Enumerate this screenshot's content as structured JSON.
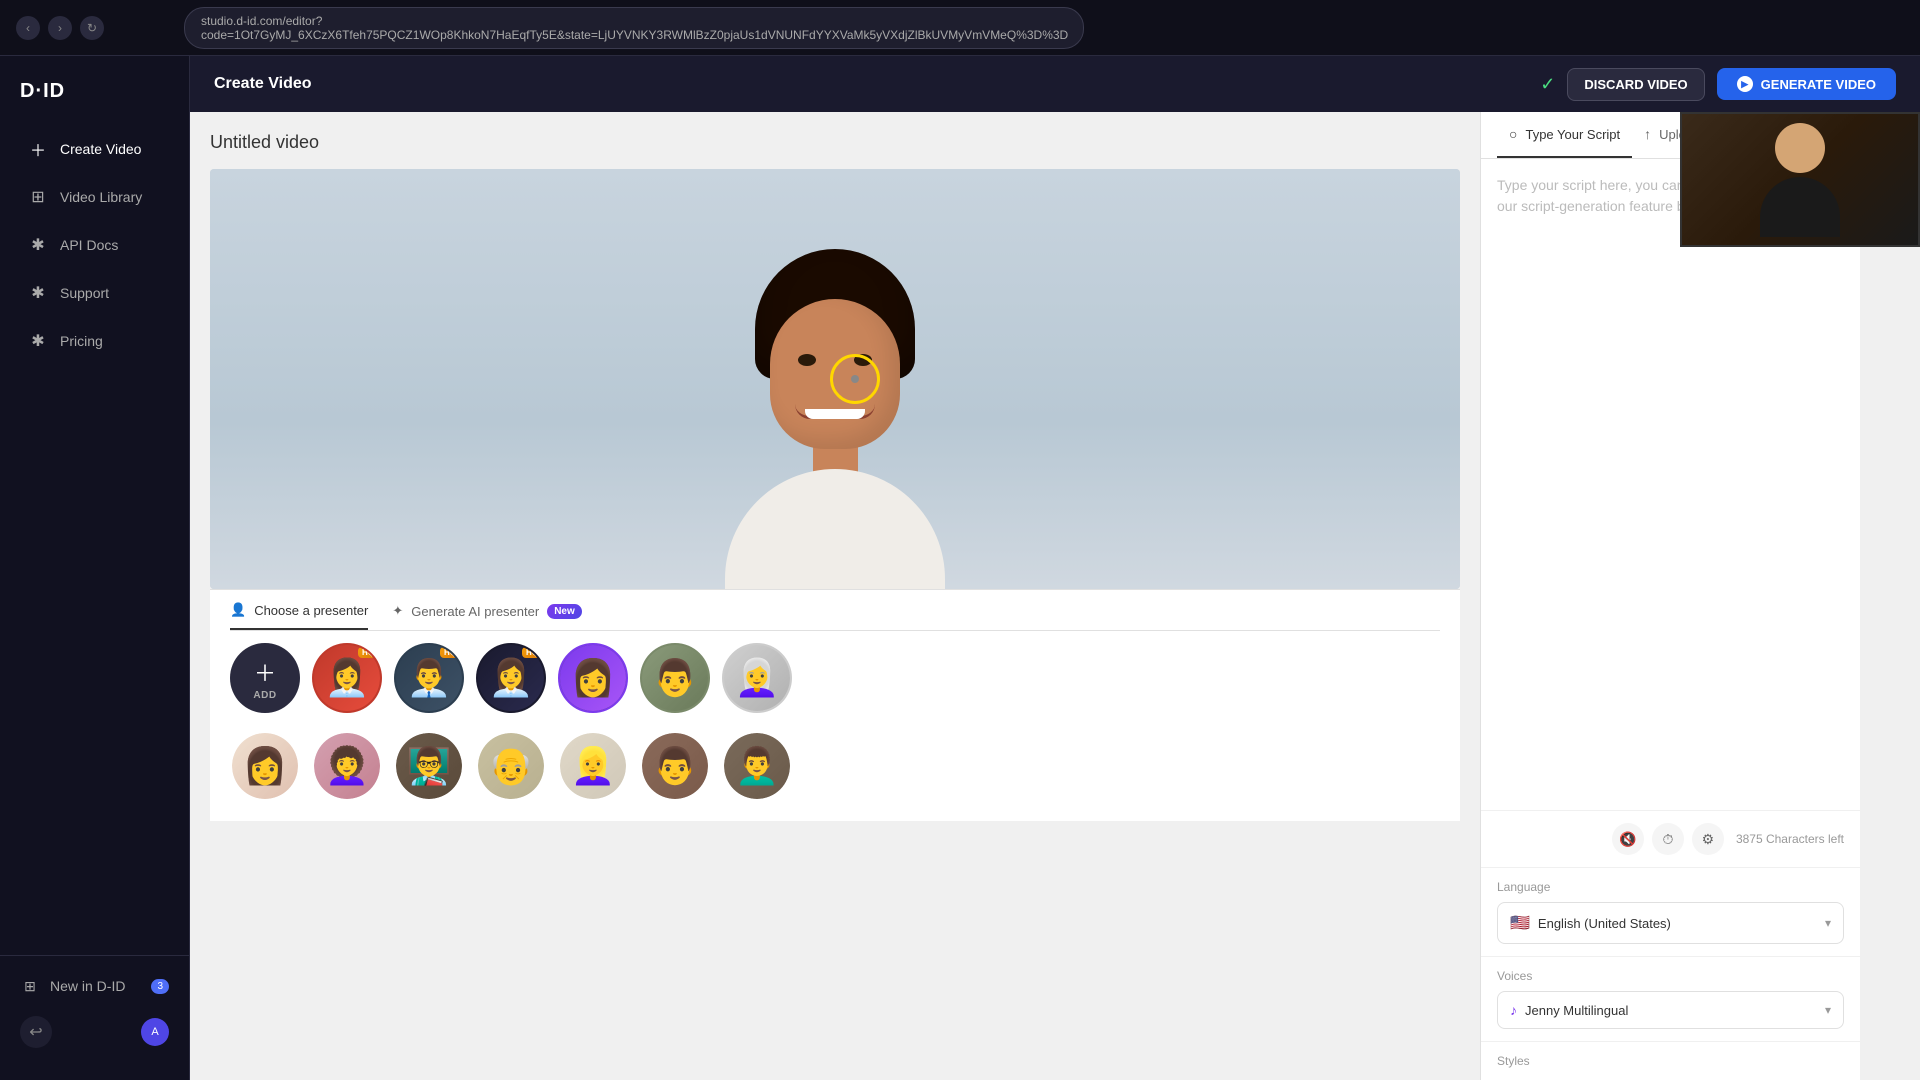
{
  "browser": {
    "url": "studio.d-id.com/editor?code=1Ot7GyMJ_6XCzX6Tfeh75PQCZ1WOp8KhkoN7HaEqfTy5E&state=LjUYVNKY3RWMlBzZ0pjaUs1dVNUNFdYYXVaMk5yVXdjZlBkUVMyVmVMeQ%3D%3D"
  },
  "header": {
    "title": "Create Video",
    "discard_btn": "DISCARD VIDEO",
    "generate_btn": "GENERATE VIDEO"
  },
  "sidebar": {
    "logo": "D·ID",
    "items": [
      {
        "label": "Create Video",
        "icon": "➕"
      },
      {
        "label": "Video Library",
        "icon": "▦"
      },
      {
        "label": "API Docs",
        "icon": "✱"
      },
      {
        "label": "Support",
        "icon": "✱"
      },
      {
        "label": "Pricing",
        "icon": "✱"
      }
    ],
    "bottom": {
      "new_in_did": "New in D-ID",
      "badge": "3"
    }
  },
  "video": {
    "title": "Untitled video"
  },
  "presenter_tabs": [
    {
      "label": "Choose a presenter",
      "icon": "👤",
      "active": true
    },
    {
      "label": "Generate AI presenter",
      "icon": "✦",
      "active": false,
      "badge": "New"
    }
  ],
  "avatars_row1": [
    {
      "id": "add",
      "label": "ADD",
      "type": "add"
    },
    {
      "id": "av1",
      "bg": "#c0392b",
      "emoji": "👩‍💼",
      "hq": true
    },
    {
      "id": "av2",
      "bg": "#2c3e50",
      "emoji": "👨‍💼",
      "hq": true
    },
    {
      "id": "av3",
      "bg": "#1a1a2e",
      "emoji": "👩‍💼",
      "hq": true
    },
    {
      "id": "av4",
      "bg": "#6b3fa0",
      "emoji": "👩",
      "selected": true
    },
    {
      "id": "av5",
      "bg": "#7a8a6a",
      "emoji": "👨"
    },
    {
      "id": "av6",
      "bg": "#ccc",
      "emoji": "👩‍🦳"
    }
  ],
  "avatars_row2": [
    {
      "id": "av7",
      "bg": "#f0e0d0",
      "emoji": "👩"
    },
    {
      "id": "av8",
      "bg": "#d4a0b0",
      "emoji": "👩‍🦱"
    },
    {
      "id": "av9",
      "bg": "#5a4a3a",
      "emoji": "👨‍🏫"
    },
    {
      "id": "av10",
      "bg": "#c8c8a0",
      "emoji": "👴"
    },
    {
      "id": "av11",
      "bg": "#e0d8c8",
      "emoji": "👱‍♀️"
    },
    {
      "id": "av12",
      "bg": "#8a6a5a",
      "emoji": "👨"
    },
    {
      "id": "av13",
      "bg": "#6a5a4a",
      "emoji": "👨‍🦱"
    }
  ],
  "script": {
    "tab_type": "Type Your Script",
    "tab_upload": "Upload Voice Audio",
    "placeholder": "Type your script here, you can start from scratch or use our script-generation feature below.",
    "chars_left": "3875 Characters left"
  },
  "language": {
    "label": "Language",
    "flag": "🇺🇸",
    "value": "English (United States)"
  },
  "voices": {
    "label": "Voices",
    "value": "Jenny Multilingual"
  },
  "styles": {
    "label": "Styles"
  }
}
